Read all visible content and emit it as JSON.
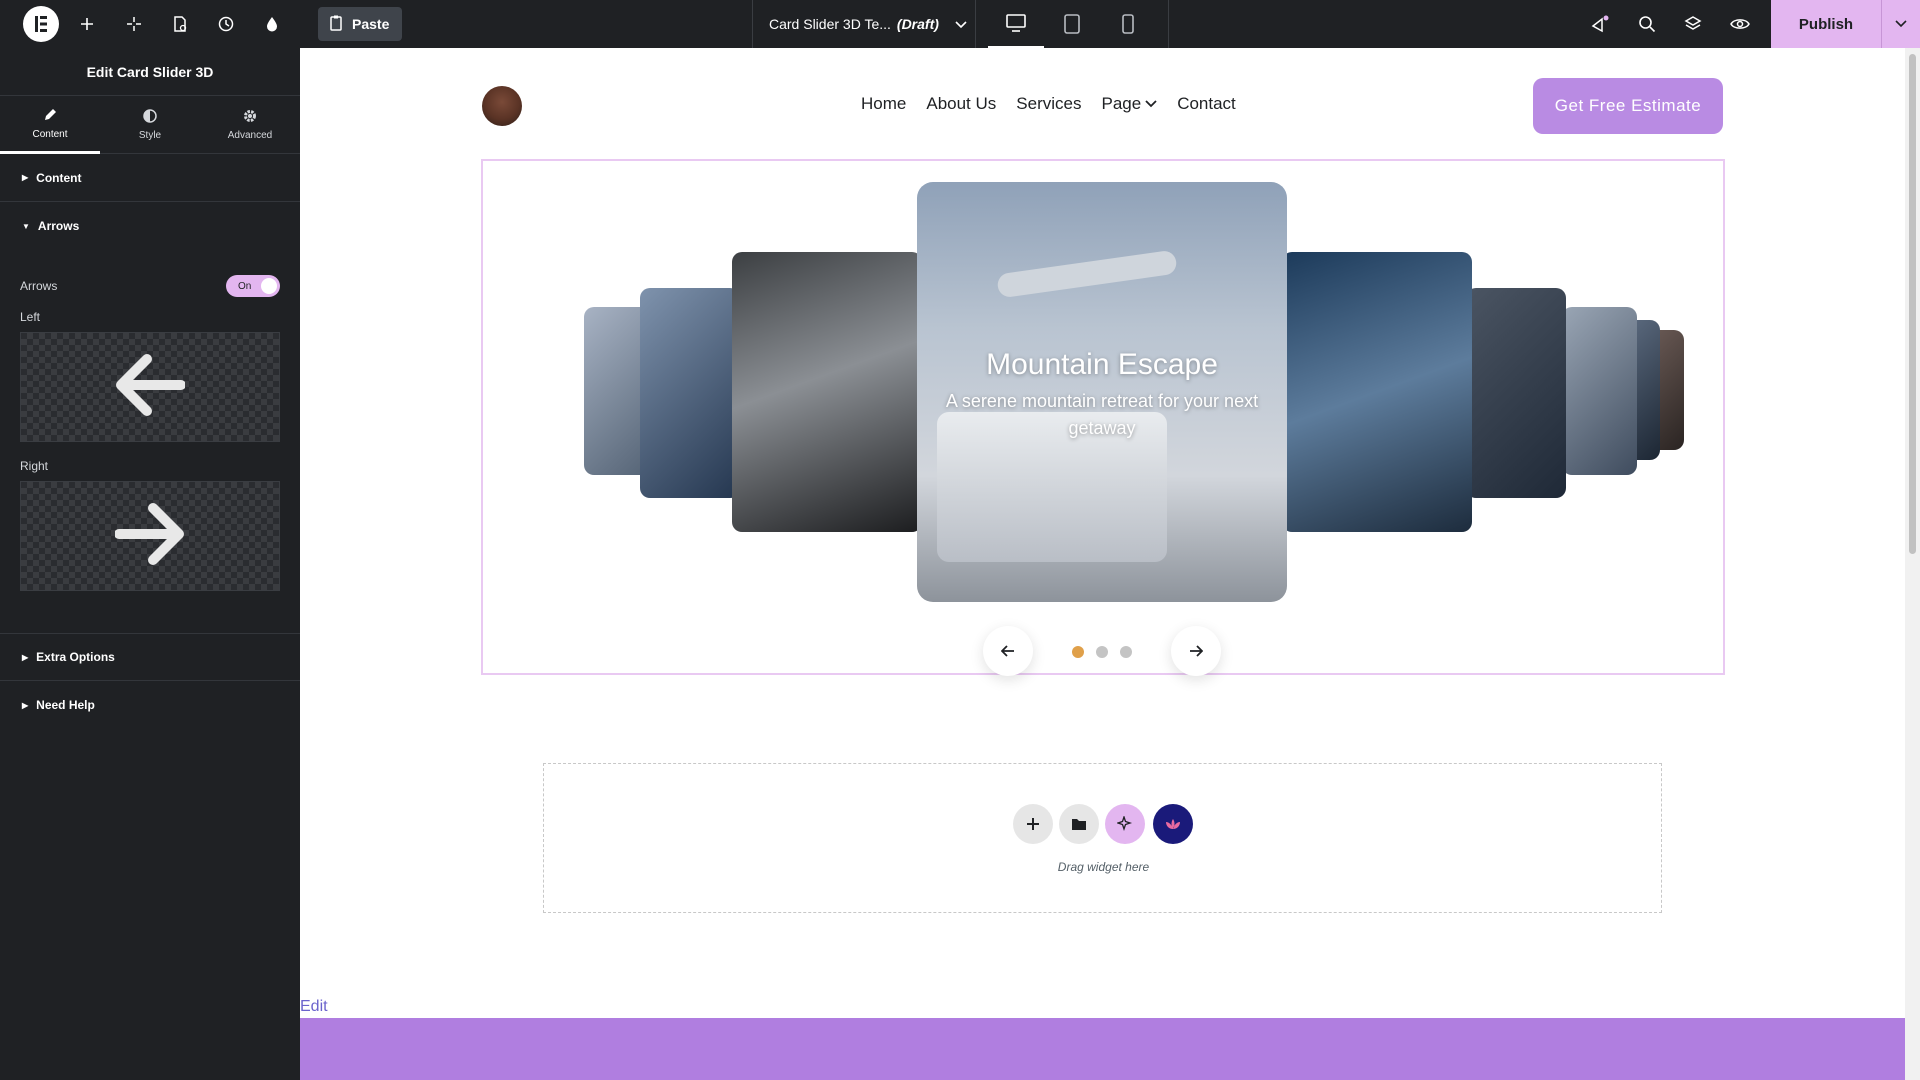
{
  "topbar": {
    "paste_label": "Paste",
    "doc_title": "Card Slider 3D Te...",
    "doc_status": "(Draft)",
    "publish_label": "Publish"
  },
  "panel": {
    "title": "Edit Card Slider 3D",
    "tabs": [
      {
        "label": "Content"
      },
      {
        "label": "Style"
      },
      {
        "label": "Advanced"
      }
    ],
    "sections": {
      "content": "Content",
      "arrows": "Arrows",
      "extra": "Extra Options",
      "help": "Need Help"
    },
    "arrows_label": "Arrows",
    "arrows_toggle": "On",
    "left_label": "Left",
    "right_label": "Right"
  },
  "site": {
    "nav": [
      "Home",
      "About Us",
      "Services",
      "Page",
      "Contact"
    ],
    "cta_label": "Get Free Estimate"
  },
  "slider": {
    "title": "Mountain Escape",
    "description": "A serene mountain retreat for your next getaway",
    "active_dot": 0,
    "dot_count": 3
  },
  "dropzone": {
    "text": "Drag widget here"
  },
  "edit_link": "Edit",
  "colors": {
    "accent": "#e3b6f0",
    "cta": "#b98be3",
    "footer": "#b07ee0",
    "active_dot": "#e0a04a",
    "panel_bg": "#1f2124"
  }
}
